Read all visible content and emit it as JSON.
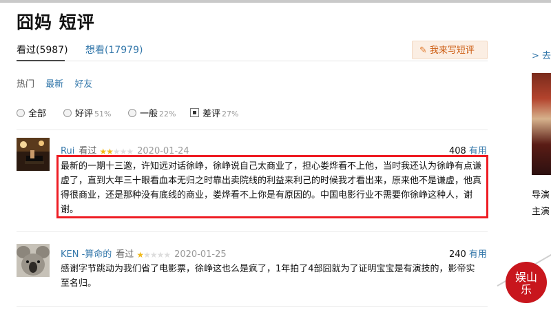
{
  "header": {
    "title": "囧妈 短评"
  },
  "tabs": [
    {
      "label": "看过(5987)",
      "active": true
    },
    {
      "label": "想看(17979)",
      "active": false
    }
  ],
  "write_button": {
    "label": "我来写短评",
    "icon": "pencil-icon"
  },
  "sort": {
    "items": [
      "热门",
      "最新",
      "好友"
    ],
    "selected": "热门"
  },
  "filters": [
    {
      "label": "全部",
      "percent": ""
    },
    {
      "label": "好评",
      "percent": "51%"
    },
    {
      "label": "一般",
      "percent": "22%"
    },
    {
      "label": "差评",
      "percent": "27%",
      "checked": true
    }
  ],
  "comments": [
    {
      "user": "Rui",
      "status": "看过",
      "rating": 2,
      "date": "2020-01-24",
      "votes": "408",
      "useful_label": "有用",
      "text": "最新的一期十三邀，许知远对话徐峥，徐峥说自己太商业了，担心娄烨看不上他，当时我还认为徐峥有点谦虚了，直到大年三十眼看血本无归之时靠出卖院线的利益来利己的时候我才看出来，原来他不是谦虚，他真得很商业，还是那种没有底线的商业，娄烨看不上你是有原因的。中国电影行业不需要你徐峥这种人，谢谢。"
    },
    {
      "user": "KEN -算命的",
      "status": "看过",
      "rating": 1,
      "date": "2020-01-25",
      "votes": "240",
      "useful_label": "有用",
      "text": "感谢字节跳动为我们省了电影票，徐峥这也么是疯了，1年拍了4部囧就为了证明宝宝是有演技的，影帝实至名归。"
    }
  ],
  "sidebar": {
    "link_text": "> 去",
    "line1": "导演",
    "line2": "主演"
  },
  "colors": {
    "link": "#3377aa",
    "highlight_border": "#ee1c23",
    "star": "#f0b91a",
    "write_button_bg": "#fbeee3"
  },
  "watermark": {
    "text": "娱乐山"
  }
}
